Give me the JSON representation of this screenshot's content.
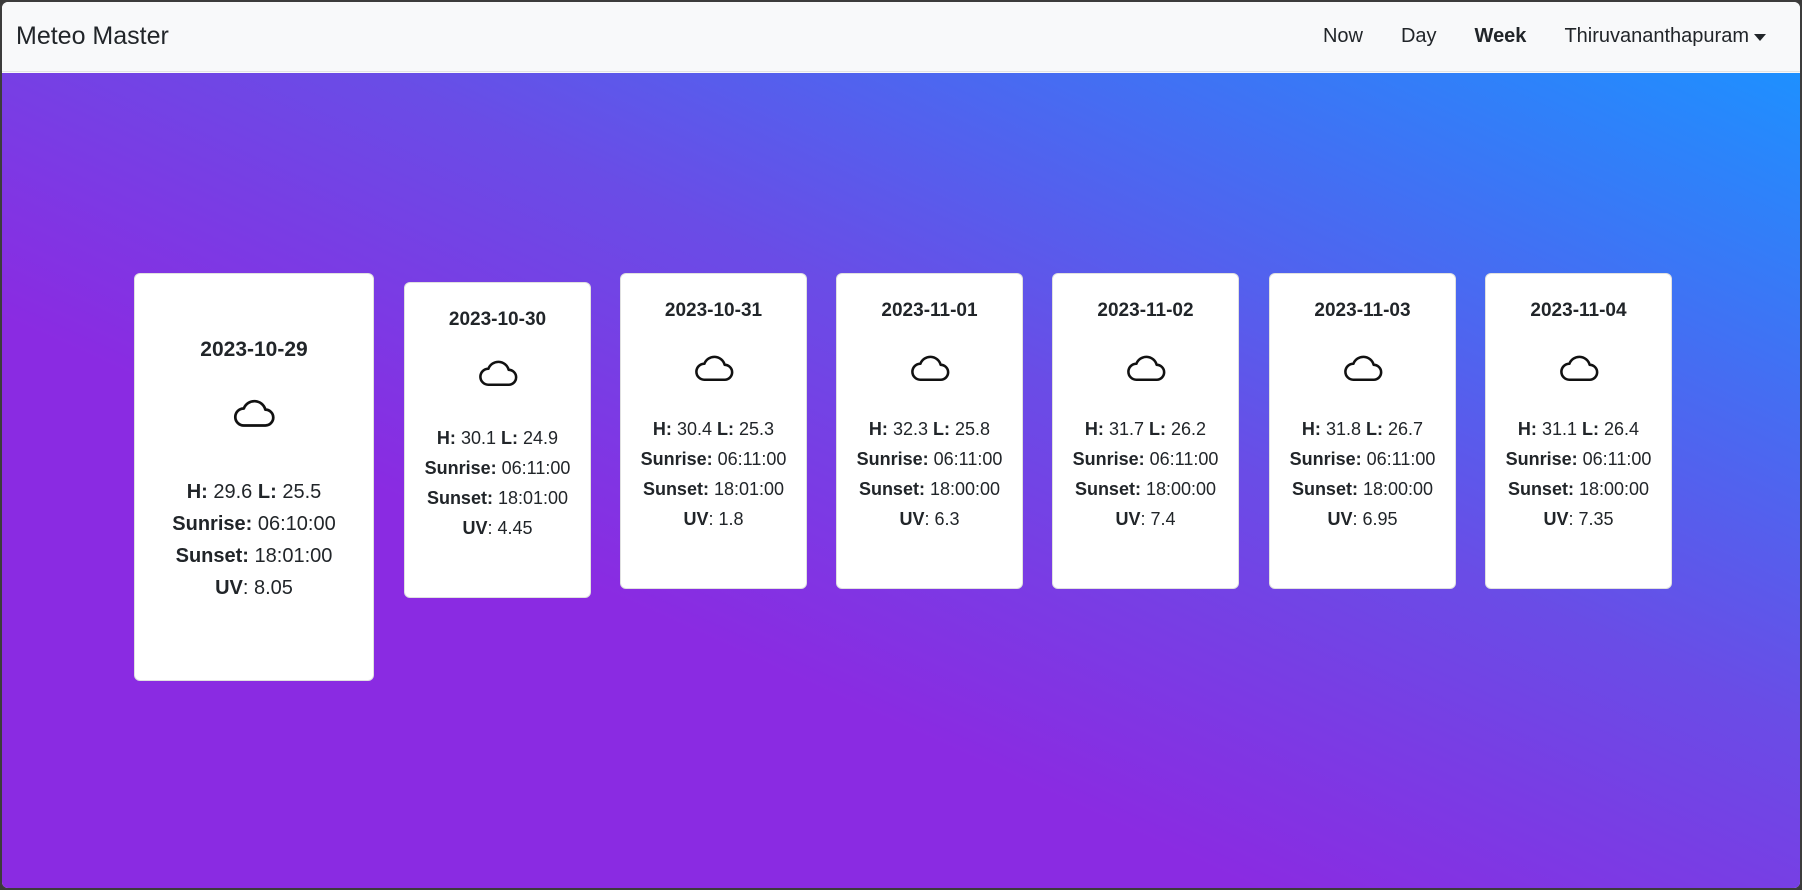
{
  "navbar": {
    "brand": "Meteo Master",
    "links": [
      "Now",
      "Day",
      "Week"
    ],
    "active": "Week",
    "city": "Thiruvananthapuram"
  },
  "labels": {
    "high": "H:",
    "low": "L:",
    "sunrise": "Sunrise:",
    "sunset": "Sunset:",
    "uv": "UV"
  },
  "days": [
    {
      "date": "2023-10-29",
      "icon": "cloud-icon",
      "high": "29.6",
      "low": "25.5",
      "sunrise": "06:10:00",
      "sunset": "18:01:00",
      "uv": "8.05"
    },
    {
      "date": "2023-10-30",
      "icon": "cloud-icon",
      "high": "30.1",
      "low": "24.9",
      "sunrise": "06:11:00",
      "sunset": "18:01:00",
      "uv": "4.45"
    },
    {
      "date": "2023-10-31",
      "icon": "cloud-icon",
      "high": "30.4",
      "low": "25.3",
      "sunrise": "06:11:00",
      "sunset": "18:01:00",
      "uv": "1.8"
    },
    {
      "date": "2023-11-01",
      "icon": "cloud-icon",
      "high": "32.3",
      "low": "25.8",
      "sunrise": "06:11:00",
      "sunset": "18:00:00",
      "uv": "6.3"
    },
    {
      "date": "2023-11-02",
      "icon": "cloud-icon",
      "high": "31.7",
      "low": "26.2",
      "sunrise": "06:11:00",
      "sunset": "18:00:00",
      "uv": "7.4"
    },
    {
      "date": "2023-11-03",
      "icon": "cloud-icon",
      "high": "31.8",
      "low": "26.7",
      "sunrise": "06:11:00",
      "sunset": "18:00:00",
      "uv": "6.95"
    },
    {
      "date": "2023-11-04",
      "icon": "cloud-icon",
      "high": "31.1",
      "low": "26.4",
      "sunrise": "06:11:00",
      "sunset": "18:00:00",
      "uv": "7.35"
    }
  ]
}
